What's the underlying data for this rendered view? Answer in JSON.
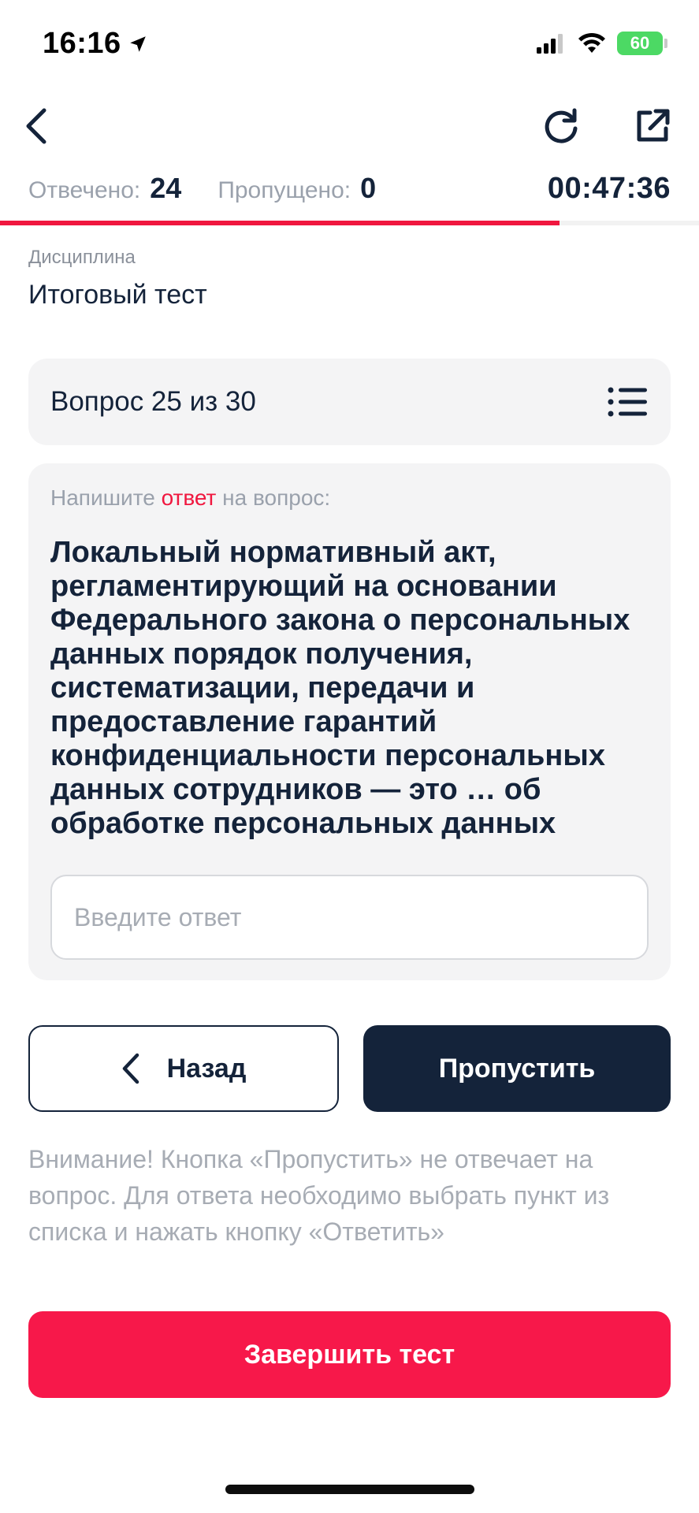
{
  "status_bar": {
    "time": "16:16",
    "battery": "60",
    "icons": [
      "location-arrow-icon",
      "cellular-signal-icon",
      "wifi-icon",
      "battery-charging-icon"
    ]
  },
  "nav": {
    "icons": [
      "chevron-left-icon",
      "refresh-icon",
      "external-link-icon"
    ]
  },
  "stats": {
    "answered_label": "Отвечено:",
    "answered_value": "24",
    "skipped_label": "Пропущено:",
    "skipped_value": "0",
    "timer": "00:47:36",
    "progress": 0.8
  },
  "discipline": {
    "label": "Дисциплина",
    "value": "Итоговый тест"
  },
  "question": {
    "counter": "Вопрос 25 из 30",
    "prompt_before": "Напишите ",
    "prompt_accent": "ответ",
    "prompt_after": " на вопрос:",
    "text": "Локальный нормативный акт, регламентирующий на основании Федерального закона о персональных данных порядок получения, систематизации, передачи и предоставление гарантий конфиденциальности персональных данных сотрудников — это … об обработке персональных данных",
    "answer_placeholder": "Введите ответ",
    "answer_value": ""
  },
  "buttons": {
    "back": "Назад",
    "skip": "Пропустить",
    "finish": "Завершить тест"
  },
  "notice": "Внимание! Кнопка «Пропустить» не отвечает на вопрос. Для ответа необходимо выбрать пункт из списка и нажать кнопку «Ответить»",
  "colors": {
    "accent": "#f0173f",
    "dark": "#14233a",
    "muted": "#9aa1ac",
    "card": "#f4f4f5",
    "battery": "#4cd964"
  }
}
